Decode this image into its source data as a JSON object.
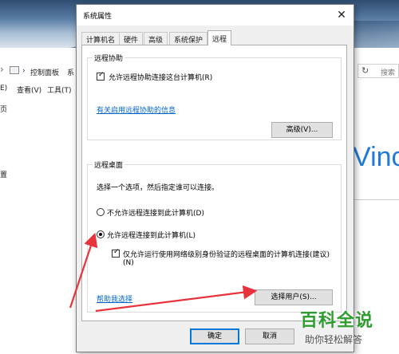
{
  "background": {
    "nav_path_1": "控制面板",
    "nav_path_2": "系",
    "menu_edit": "E)",
    "menu_view": "查看(V)",
    "menu_tools": "工具(T)",
    "side_1": "页",
    "side_2": "置",
    "refresh_glyph": "↻",
    "search_placeholder": "搜索",
    "brand_text": "Vinc"
  },
  "dialog": {
    "title": "系统属性",
    "close_glyph": "✕",
    "tabs": [
      {
        "label": "计算机名"
      },
      {
        "label": "硬件"
      },
      {
        "label": "高级"
      },
      {
        "label": "系统保护"
      },
      {
        "label": "远程"
      }
    ],
    "remote_assistance": {
      "group_title": "远程协助",
      "allow_checkbox_label": "允许远程协助连接这台计算机(R)",
      "allow_checked": true,
      "help_link": "有关启用远程协助的信息",
      "advanced_button": "高级(V)..."
    },
    "remote_desktop": {
      "group_title": "远程桌面",
      "instruction": "选择一个选项，然后指定谁可以连接。",
      "option_deny": "不允许远程连接到此计算机(D)",
      "option_allow": "允许远程连接到此计算机(L)",
      "selected": "allow",
      "nla_checkbox_label_line1": "仅允许运行使用网络级别身份验证的远程桌面的计算机连接(建议)",
      "nla_checkbox_label_line2": "(N)",
      "nla_checked": true,
      "help_link": "帮助我选择",
      "select_users_button": "选择用户(S)..."
    },
    "ok_button": "确定",
    "cancel_button": "取消"
  },
  "annotations": {
    "arrow_color": "#e8323c"
  },
  "watermark": {
    "main_text": "百科全说",
    "sub_text": "助你轻松解答"
  }
}
